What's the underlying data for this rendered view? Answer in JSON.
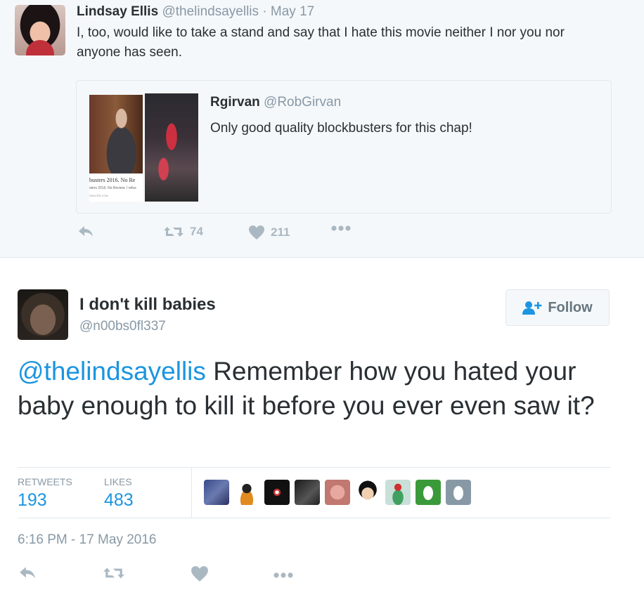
{
  "parent_tweet": {
    "name": "Lindsay Ellis",
    "handle": "@thelindsayellis",
    "separator": "·",
    "date": "May 17",
    "text": "I, too, would like to take a stand and say that I hate this movie neither I nor you nor anyone has seen.",
    "quoted": {
      "name": "Rgirvan",
      "handle": "@RobGirvan",
      "text": "Only good quality blockbusters for this chap!",
      "image_caption_1": "busters 2016. No Re",
      "image_caption_2": "sters 2016. No Review. I refus",
      "image_caption_3": "SEACRE.COM"
    },
    "actions": {
      "reply_icon": "reply-icon",
      "retweet_icon": "retweet-icon",
      "retweet_count": "74",
      "like_icon": "heart-icon",
      "like_count": "211",
      "more_icon": "more-icon"
    }
  },
  "main_tweet": {
    "name": "I don't kill babies",
    "handle": "@n00bs0fl337",
    "follow_label": "Follow",
    "mention": "@thelindsayellis",
    "text": " Remember how you hated your baby enough to kill it before you ever even saw it?",
    "stats": {
      "retweets_label": "RETWEETS",
      "retweets_count": "193",
      "likes_label": "LIKES",
      "likes_count": "483"
    },
    "timestamp": "6:16 PM - 17 May 2016",
    "colors": {
      "link": "#1b95e0",
      "muted": "#8899a6",
      "icon": "#aab8c2",
      "text": "#292f33"
    }
  }
}
